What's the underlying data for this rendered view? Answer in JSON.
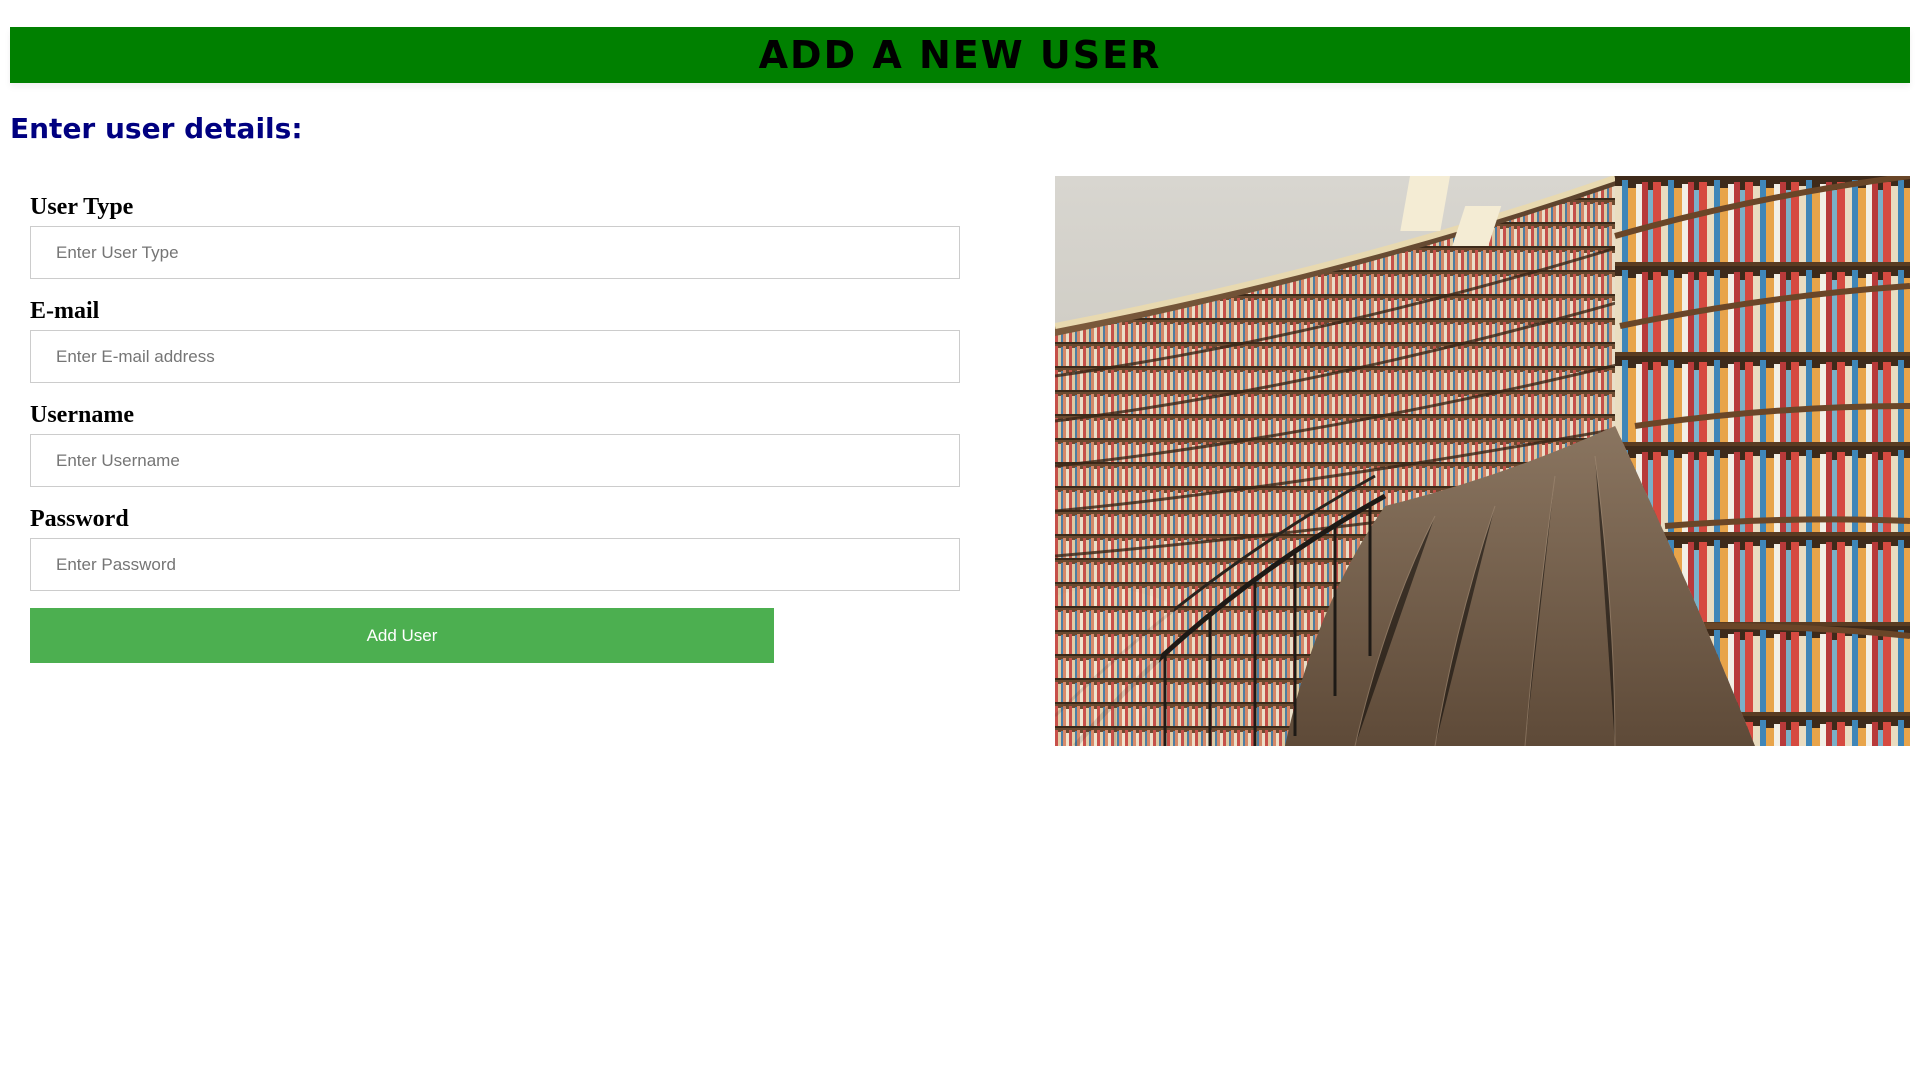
{
  "header": {
    "title": "ADD A NEW USER"
  },
  "section": {
    "subtitle": "Enter user details:"
  },
  "form": {
    "fields": [
      {
        "label": "User Type",
        "placeholder": "Enter User Type",
        "value": ""
      },
      {
        "label": "E-mail",
        "placeholder": "Enter E-mail address",
        "value": ""
      },
      {
        "label": "Username",
        "placeholder": "Enter Username",
        "value": ""
      },
      {
        "label": "Password",
        "placeholder": "Enter Password",
        "value": ""
      }
    ],
    "submit_label": "Add User"
  },
  "colors": {
    "banner": "#008000",
    "subtitle": "#000080",
    "button": "#4caf50"
  }
}
